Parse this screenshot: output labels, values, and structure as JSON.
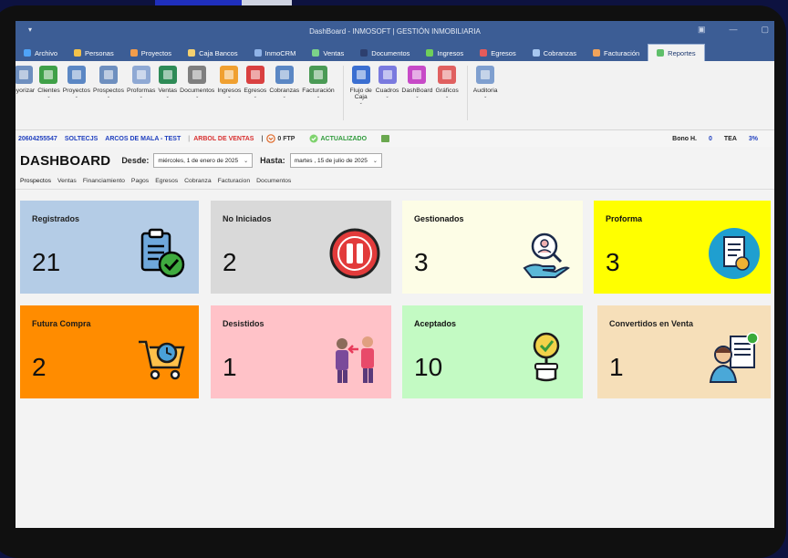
{
  "window": {
    "title": "DashBoard - INMOSOFT | GESTIÓN INMOBILIARIA",
    "quick": "▾",
    "controls": [
      "▣",
      "—",
      "▢"
    ]
  },
  "menu": [
    {
      "label": "Archivo",
      "color": "#4fa3f7"
    },
    {
      "label": "Personas",
      "color": "#f3c24a"
    },
    {
      "label": "Proyectos",
      "color": "#f39c4a"
    },
    {
      "label": "Caja Bancos",
      "color": "#f4d06f"
    },
    {
      "label": "InmoCRM",
      "color": "#8fb3e8"
    },
    {
      "label": "Ventas",
      "color": "#7bd389"
    },
    {
      "label": "Documentos",
      "color": "#2d3f6e"
    },
    {
      "label": "Ingresos",
      "color": "#6fcf5a"
    },
    {
      "label": "Egresos",
      "color": "#e55b5b"
    },
    {
      "label": "Cobranzas",
      "color": "#a7c7f0"
    },
    {
      "label": "Facturación",
      "color": "#f0a35b"
    },
    {
      "label": "Reportes",
      "color": "#5fbf6a",
      "active": true
    }
  ],
  "ribbon": [
    {
      "label": "eyorizar",
      "color": "#6e8fbf",
      "caret": ""
    },
    {
      "label": "Clientes",
      "color": "#3fa048",
      "caret": "⌄"
    },
    {
      "label": "Proyectos",
      "color": "#5b87c4",
      "caret": "⌄"
    },
    {
      "label": "Prospectos",
      "color": "#6e8fbf",
      "caret": "⌄"
    },
    {
      "label": "Proformas",
      "color": "#8fa9d4",
      "caret": "⌄"
    },
    {
      "label": "Ventas",
      "color": "#2e8b57",
      "caret": "⌄"
    },
    {
      "label": "Documentos",
      "color": "#7f7f7f",
      "caret": "⌄"
    },
    {
      "label": "Ingresos",
      "color": "#f0a030",
      "caret": "⌄"
    },
    {
      "label": "Egresos",
      "color": "#d94040",
      "caret": "⌄"
    },
    {
      "label": "Cobranzas",
      "color": "#5b87c4",
      "caret": "⌄"
    },
    {
      "label": "Facturación",
      "color": "#4a9a55",
      "caret": "⌄"
    },
    {
      "label": "Flujo de Caja",
      "color": "#3b6fd1",
      "caret": "⌄"
    },
    {
      "label": "Cuadros",
      "color": "#7a7adf",
      "caret": "⌄"
    },
    {
      "label": "DashBoard",
      "color": "#c74ac7",
      "caret": "⌄"
    },
    {
      "label": "Gráficos",
      "color": "#e06060",
      "caret": "⌄"
    },
    {
      "label": "Auditoria",
      "color": "#7f9fcf",
      "caret": "⌄"
    }
  ],
  "status": {
    "ruc": "20604255547",
    "company": "SOLTECJS",
    "project": "ARCOS DE MALA - TEST",
    "tree": "ARBOL DE VENTAS",
    "ftp": "0 FTP",
    "updated": "ACTUALIZADO",
    "bono": "Bono H.",
    "bono_value": "0",
    "tea": "TEA",
    "tea_value": "3%"
  },
  "dashboard": {
    "title": "DASHBOARD",
    "from_label": "Desde:",
    "from_value": "miércoles,  1 de   enero   de 2025",
    "to_label": "Hasta:",
    "to_value": "martes  , 15 de    julio     de 2025"
  },
  "tabs": [
    "Prospectos",
    "Ventas",
    "Financiamiento",
    "Pagos",
    "Egresos",
    "Cobranza",
    "Facturacion",
    "Documentos"
  ],
  "cards": [
    {
      "label": "Registrados",
      "value": "21",
      "bg": "#b4cce6",
      "icon": "clipboard-check-icon"
    },
    {
      "label": "No Iniciados",
      "value": "2",
      "bg": "#d9d9d9",
      "icon": "pause-icon"
    },
    {
      "label": "Gestionados",
      "value": "3",
      "bg": "#fdfde6",
      "icon": "hand-magnifier-icon"
    },
    {
      "label": "Proforma",
      "value": "3",
      "bg": "#ffff00",
      "icon": "invoice-icon"
    },
    {
      "label": "Futura Compra",
      "value": "2",
      "bg": "#ff8c00",
      "icon": "cart-clock-icon"
    },
    {
      "label": "Desistidos",
      "value": "1",
      "bg": "#ffc2c8",
      "icon": "people-exchange-icon"
    },
    {
      "label": "Aceptados",
      "value": "10",
      "bg": "#c3fac3",
      "icon": "approval-hand-icon"
    },
    {
      "label": "Convertidos en Venta",
      "value": "1",
      "bg": "#f6dfb9",
      "icon": "person-document-icon"
    }
  ],
  "colors": {
    "titlebar": "#3c5d95",
    "status_blue": "#1f3fbf",
    "status_red": "#d83030",
    "status_green": "#2e9a3a"
  }
}
